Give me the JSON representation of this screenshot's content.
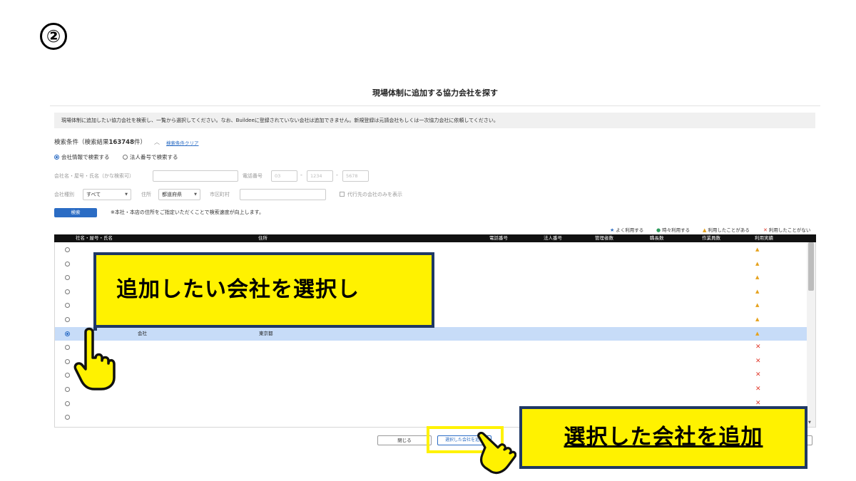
{
  "step_number": "②",
  "modal": {
    "title": "現場体制に追加する協力会社を探す",
    "notice": "現場体制に追加したい協力会社を検索し、一覧から選択してください。なお、Buildeeに登録されていない会社は追加できません。新規登録は元請会社もしくは一次協力会社に依頼してください。"
  },
  "search": {
    "conditions_label": "検索条件（検索結果",
    "result_count": "163748",
    "conditions_suffix": "件）",
    "clear_link": "検索条件クリア",
    "mode_options": [
      "会社情報で検索する",
      "法人番号で検索する"
    ],
    "selected_mode": 0,
    "company_name_label": "会社名・屋号・氏名（かな検索可）",
    "company_name_value": "",
    "phone_label": "電話番号",
    "phone_placeholders": [
      "03",
      "1234",
      "5678"
    ],
    "type_label": "会社種別",
    "type_value": "すべて",
    "address_label": "住所",
    "prefecture_value": "都道府県",
    "city_label": "市区町村",
    "city_value": "",
    "agent_only_label": "代行先の会社のみを表示",
    "search_button": "検索",
    "search_note": "※本社・本店の住所をご指定いただくことで検索速度が向上します。"
  },
  "legend": {
    "often": "よく利用する",
    "sometimes": "時々利用する",
    "used": "利用したことがある",
    "never": "利用したことがない",
    "colors": {
      "often": "#2b6cc4",
      "sometimes": "#2e9c5e",
      "used": "#e6a21c",
      "never": "#e0392b"
    }
  },
  "table": {
    "headers": {
      "name": "社名・屋号・氏名",
      "address": "住所",
      "phone": "電話番号",
      "corp_no": "法人番号",
      "managers": "管理者数",
      "foremen": "職長数",
      "workers": "作業員数",
      "usage": "利用実績"
    },
    "rows": [
      {
        "name": "",
        "address": "",
        "usage": "used",
        "selected": false
      },
      {
        "name": "",
        "address": "",
        "usage": "used",
        "selected": false
      },
      {
        "name": "",
        "address": "",
        "usage": "used",
        "selected": false
      },
      {
        "name": "",
        "address": "",
        "usage": "used",
        "selected": false
      },
      {
        "name": "",
        "address": "",
        "usage": "used",
        "selected": false
      },
      {
        "name": "",
        "address": "",
        "usage": "used",
        "selected": false
      },
      {
        "name": "会社",
        "address": "東京都",
        "usage": "used",
        "selected": true
      },
      {
        "name": "",
        "address": "",
        "usage": "never",
        "selected": false
      },
      {
        "name": "",
        "address": "",
        "usage": "never",
        "selected": false
      },
      {
        "name": "",
        "address": "",
        "usage": "never",
        "selected": false
      },
      {
        "name": "",
        "address": "",
        "usage": "never",
        "selected": false
      },
      {
        "name": "",
        "address": "",
        "usage": "never",
        "selected": false
      },
      {
        "name": "",
        "address": "",
        "usage": "none",
        "selected": false
      }
    ]
  },
  "footer": {
    "close_button": "閉じる",
    "add_button": "選択した会社を追加"
  },
  "callouts": {
    "select_company": "追加したい会社を選択し",
    "add_selected": "選択した会社を追加"
  },
  "icons": {
    "pointer": "pointing-hand-icon",
    "collapse": "chevron-up-icon"
  }
}
